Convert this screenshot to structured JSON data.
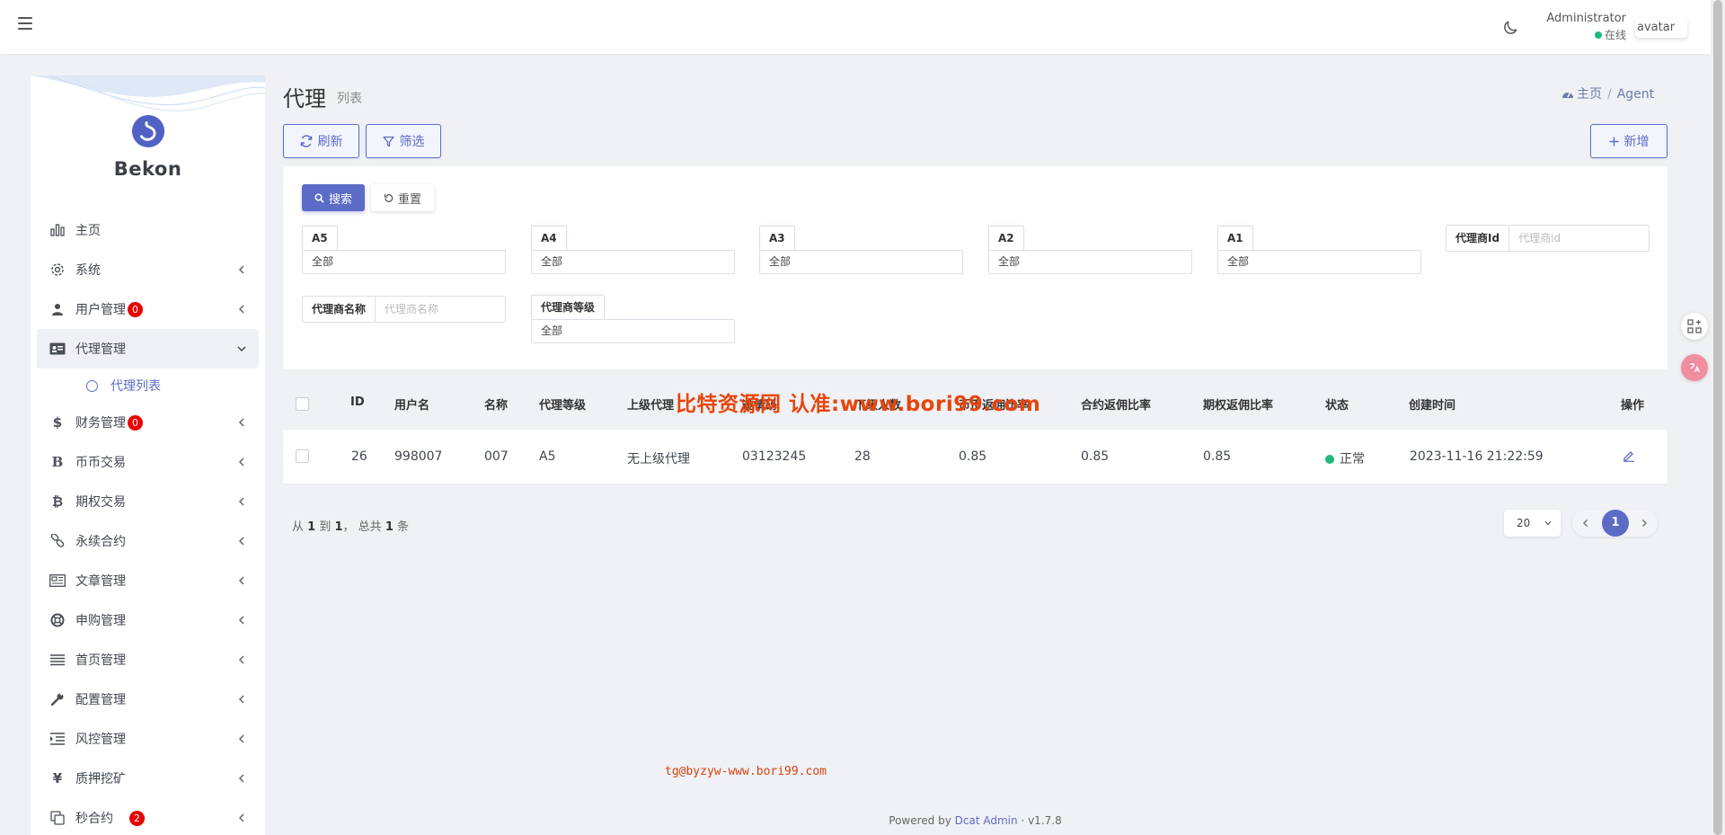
{
  "header": {
    "user_name": "Administrator",
    "user_status": "在线",
    "avatar_alt": "avatar"
  },
  "brand": {
    "name": "Bekon"
  },
  "sidebar": {
    "items": [
      {
        "label": "主页",
        "icon": "bar-chart-icon",
        "badge": ""
      },
      {
        "label": "系统",
        "icon": "gear-icon",
        "badge": ""
      },
      {
        "label": "用户管理",
        "icon": "users-icon",
        "badge": "0"
      },
      {
        "label": "代理管理",
        "icon": "id-card-icon",
        "badge": ""
      },
      {
        "label": "财务管理",
        "icon": "dollar-icon",
        "badge": "0"
      },
      {
        "label": "币币交易",
        "icon": "bitcoin-b-icon",
        "badge": ""
      },
      {
        "label": "期权交易",
        "icon": "bitcoin-icon",
        "badge": ""
      },
      {
        "label": "永续合约",
        "icon": "link-icon",
        "badge": ""
      },
      {
        "label": "文章管理",
        "icon": "newspaper-icon",
        "badge": ""
      },
      {
        "label": "申购管理",
        "icon": "life-ring-icon",
        "badge": ""
      },
      {
        "label": "首页管理",
        "icon": "bars-icon",
        "badge": ""
      },
      {
        "label": "配置管理",
        "icon": "wrench-icon",
        "badge": ""
      },
      {
        "label": "风控管理",
        "icon": "indent-icon",
        "badge": ""
      },
      {
        "label": "质押挖矿",
        "icon": "yen-icon",
        "badge": ""
      },
      {
        "label": "秒合约",
        "icon": "copy-icon",
        "badge": "2"
      }
    ],
    "sub_item": "代理列表"
  },
  "page": {
    "title": "代理",
    "subtitle": "列表",
    "breadcrumb_home": "主页",
    "breadcrumb_current": "Agent"
  },
  "toolbar": {
    "refresh": "刷新",
    "filter": "筛选",
    "create": "新增"
  },
  "filter": {
    "search": "搜索",
    "reset": "重置",
    "selects": [
      {
        "label": "A5",
        "value": "全部"
      },
      {
        "label": "A4",
        "value": "全部"
      },
      {
        "label": "A3",
        "value": "全部"
      },
      {
        "label": "A2",
        "value": "全部"
      },
      {
        "label": "A1",
        "value": "全部"
      },
      {
        "label": "代理商等级",
        "value": "全部"
      }
    ],
    "agent_id_label": "代理商Id",
    "agent_id_placeholder": "代理商id",
    "agent_name_label": "代理商名称",
    "agent_name_placeholder": "代理商名称"
  },
  "table": {
    "headers": [
      "ID",
      "用户名",
      "名称",
      "代理等级",
      "上级代理",
      "邀请码",
      "下级人数",
      "币币返佣比率",
      "合约返佣比率",
      "期权返佣比率",
      "状态",
      "创建时间",
      "操作"
    ],
    "rows": [
      {
        "id": "26",
        "username": "998007",
        "name": "007",
        "level": "A5",
        "parent": "无上级代理",
        "code": "03123245",
        "count": "28",
        "r1": "0.85",
        "r2": "0.85",
        "r3": "0.85",
        "status": "正常",
        "created": "2023-11-16 21:22:59"
      }
    ]
  },
  "pagination": {
    "from": "1",
    "to": "1",
    "total": "1",
    "text_from": "从",
    "text_to": "到",
    "text_total": "， 总共",
    "text_unit": "条",
    "per_page": "20",
    "current_page": "1"
  },
  "watermark": {
    "main": "比特资源网 认准:www.bori99.com",
    "small": "tg@byzyw-www.bori99.com"
  },
  "footer": {
    "powered": "Powered by",
    "link": "Dcat Admin",
    "version": "· v1.7.8"
  },
  "colors": {
    "accent": "#5c6bc6",
    "success": "#21b978",
    "badge": "#ea0000",
    "watermark": "#e8450a"
  }
}
